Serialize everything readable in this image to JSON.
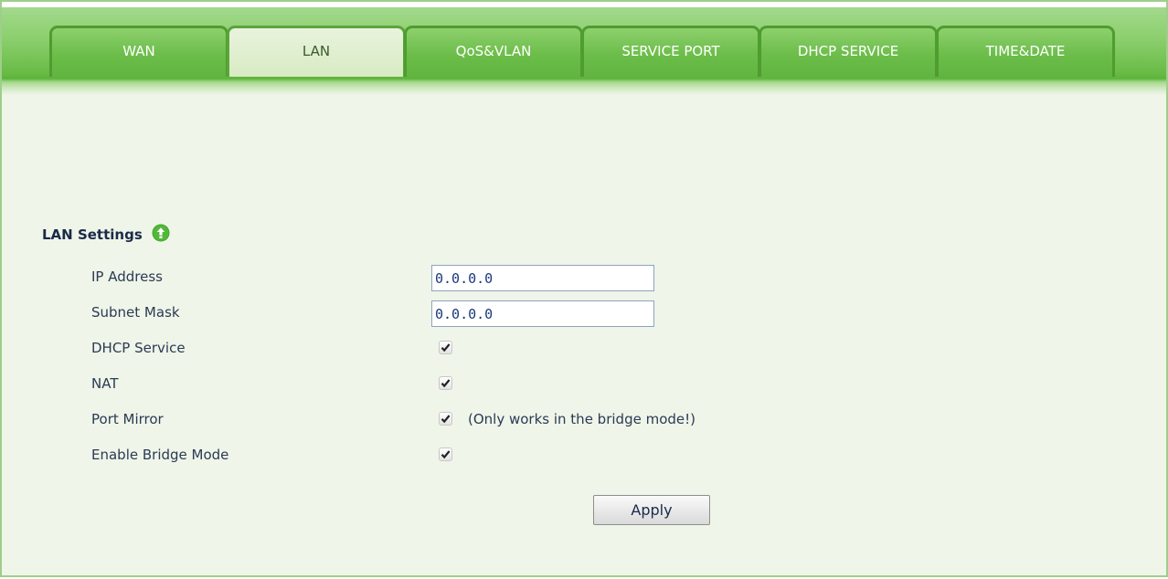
{
  "tabs": [
    {
      "label": "WAN"
    },
    {
      "label": "LAN"
    },
    {
      "label": "QoS&VLAN"
    },
    {
      "label": "SERVICE PORT"
    },
    {
      "label": "DHCP SERVICE"
    },
    {
      "label": "TIME&DATE"
    }
  ],
  "active_tab": "LAN",
  "section": {
    "title": "LAN Settings",
    "help_icon": "help-icon"
  },
  "fields": {
    "ip_address": {
      "label": "IP Address",
      "value": "0.0.0.0"
    },
    "subnet_mask": {
      "label": "Subnet Mask",
      "value": "0.0.0.0"
    },
    "dhcp_service": {
      "label": "DHCP Service",
      "checked": true
    },
    "nat": {
      "label": "NAT",
      "checked": true
    },
    "port_mirror": {
      "label": "Port Mirror",
      "checked": true,
      "note": "(Only works in the bridge mode!)"
    },
    "enable_bridge_mode": {
      "label": "Enable Bridge Mode",
      "checked": true
    }
  },
  "apply_label": "Apply",
  "colors": {
    "tab_green": "#6cbd4a",
    "active_tab": "#d8ebc3",
    "panel_bg": "#eff5e8",
    "border": "#9ecf8a",
    "help_icon": "#3fa82a"
  }
}
